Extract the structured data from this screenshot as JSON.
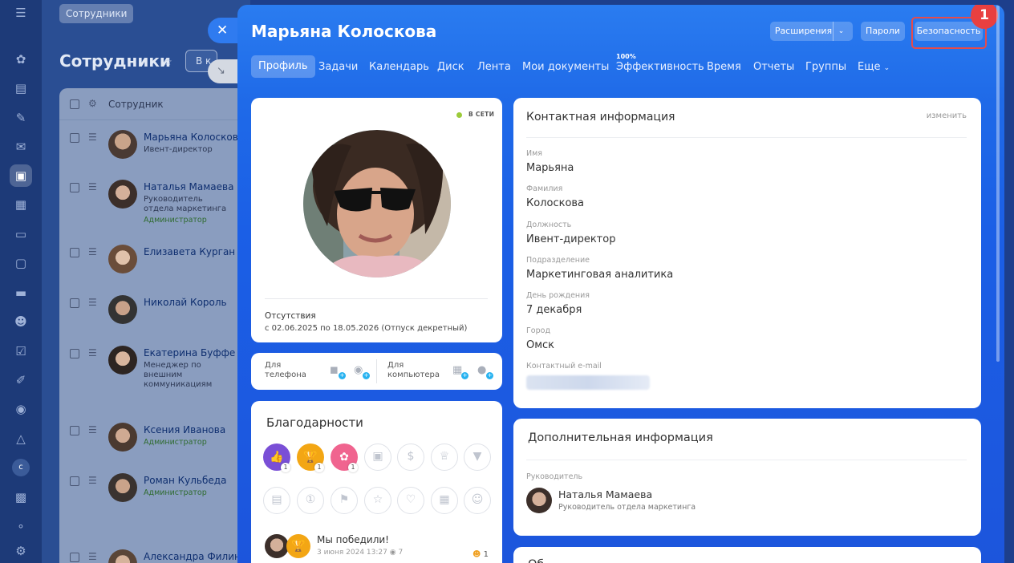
{
  "background": {
    "crumb": "Сотрудники",
    "page_title": "Сотрудники",
    "filter_chip": "В к",
    "column_header": "Сотрудник",
    "employees": [
      {
        "name": "Марьяна Колоскова",
        "position": "Ивент-директор",
        "tag": ""
      },
      {
        "name": "Наталья Мамаева",
        "position": "Руководитель отдела маркетинга",
        "tag": "Администратор"
      },
      {
        "name": "Елизавета Курган",
        "position": "",
        "tag": ""
      },
      {
        "name": "Николай Король",
        "position": "",
        "tag": ""
      },
      {
        "name": "Екатерина Буффе",
        "position": "Менеджер по внешним коммуникациям",
        "tag": ""
      },
      {
        "name": "Ксения Иванова",
        "position": "",
        "tag": "Администратор"
      },
      {
        "name": "Роман Кульбеда",
        "position": "",
        "tag": "Администратор"
      },
      {
        "name": "Александра Филина",
        "position": "",
        "tag": ""
      }
    ],
    "rail_letter": "c"
  },
  "slider": {
    "title": "Марьяна Колоскова",
    "buttons": {
      "extensions": "Расширения",
      "passwords": "Пароли",
      "security": "Безопасность"
    },
    "step_badge": "1",
    "tabs": [
      "Профиль",
      "Задачи",
      "Календарь",
      "Диск",
      "Лента",
      "Мои документы",
      "Эффективность",
      "Время",
      "Отчеты",
      "Группы",
      "Еще"
    ],
    "efficiency_percent": "100%"
  },
  "profile": {
    "status": "В СЕТИ",
    "absence_label": "Отсутствия",
    "absence_text": "с 02.06.2025 по 18.05.2026 (Отпуск декретный)",
    "apps": {
      "phone_label": "Для телефона",
      "computer_label": "Для компьютера"
    }
  },
  "thanks": {
    "title": "Благодарности",
    "badges_row1": [
      {
        "icon": "like-icon",
        "count": "1",
        "color": "#7a4fd6"
      },
      {
        "icon": "trophy-icon",
        "count": "1",
        "color": "#f3a614"
      },
      {
        "icon": "flower-icon",
        "count": "1",
        "color": "#f0648f"
      },
      {
        "icon": "gift-icon"
      },
      {
        "icon": "money-icon"
      },
      {
        "icon": "crown-icon"
      },
      {
        "icon": "cocktail-icon"
      }
    ],
    "badges_row2": [
      "cake-icon",
      "number-one-icon",
      "flag-icon",
      "star-icon",
      "heart-icon",
      "chart-icon",
      "smile-icon"
    ],
    "latest": {
      "title": "Мы победили!",
      "date": "3 июня 2024 13:27",
      "views": "7",
      "reactions": "1"
    }
  },
  "contact": {
    "title": "Контактная информация",
    "edit_link": "изменить",
    "fields": [
      {
        "label": "Имя",
        "value": "Марьяна"
      },
      {
        "label": "Фамилия",
        "value": "Колоскова"
      },
      {
        "label": "Должность",
        "value": "Ивент-директор"
      },
      {
        "label": "Подразделение",
        "value": "Маркетинговая аналитика"
      },
      {
        "label": "День рождения",
        "value": "7 декабря"
      },
      {
        "label": "Город",
        "value": "Омск"
      }
    ],
    "email_label": "Контактный e-mail"
  },
  "extra": {
    "title": "Дополнительная информация",
    "manager_label": "Руководитель",
    "manager_name": "Наталья Мамаева",
    "manager_role": "Руководитель отдела маркетинга"
  },
  "more_title": "Об",
  "colors": {
    "accent": "#2f7bf0",
    "highlight": "#e64b4b",
    "online": "#9ccb3a"
  }
}
